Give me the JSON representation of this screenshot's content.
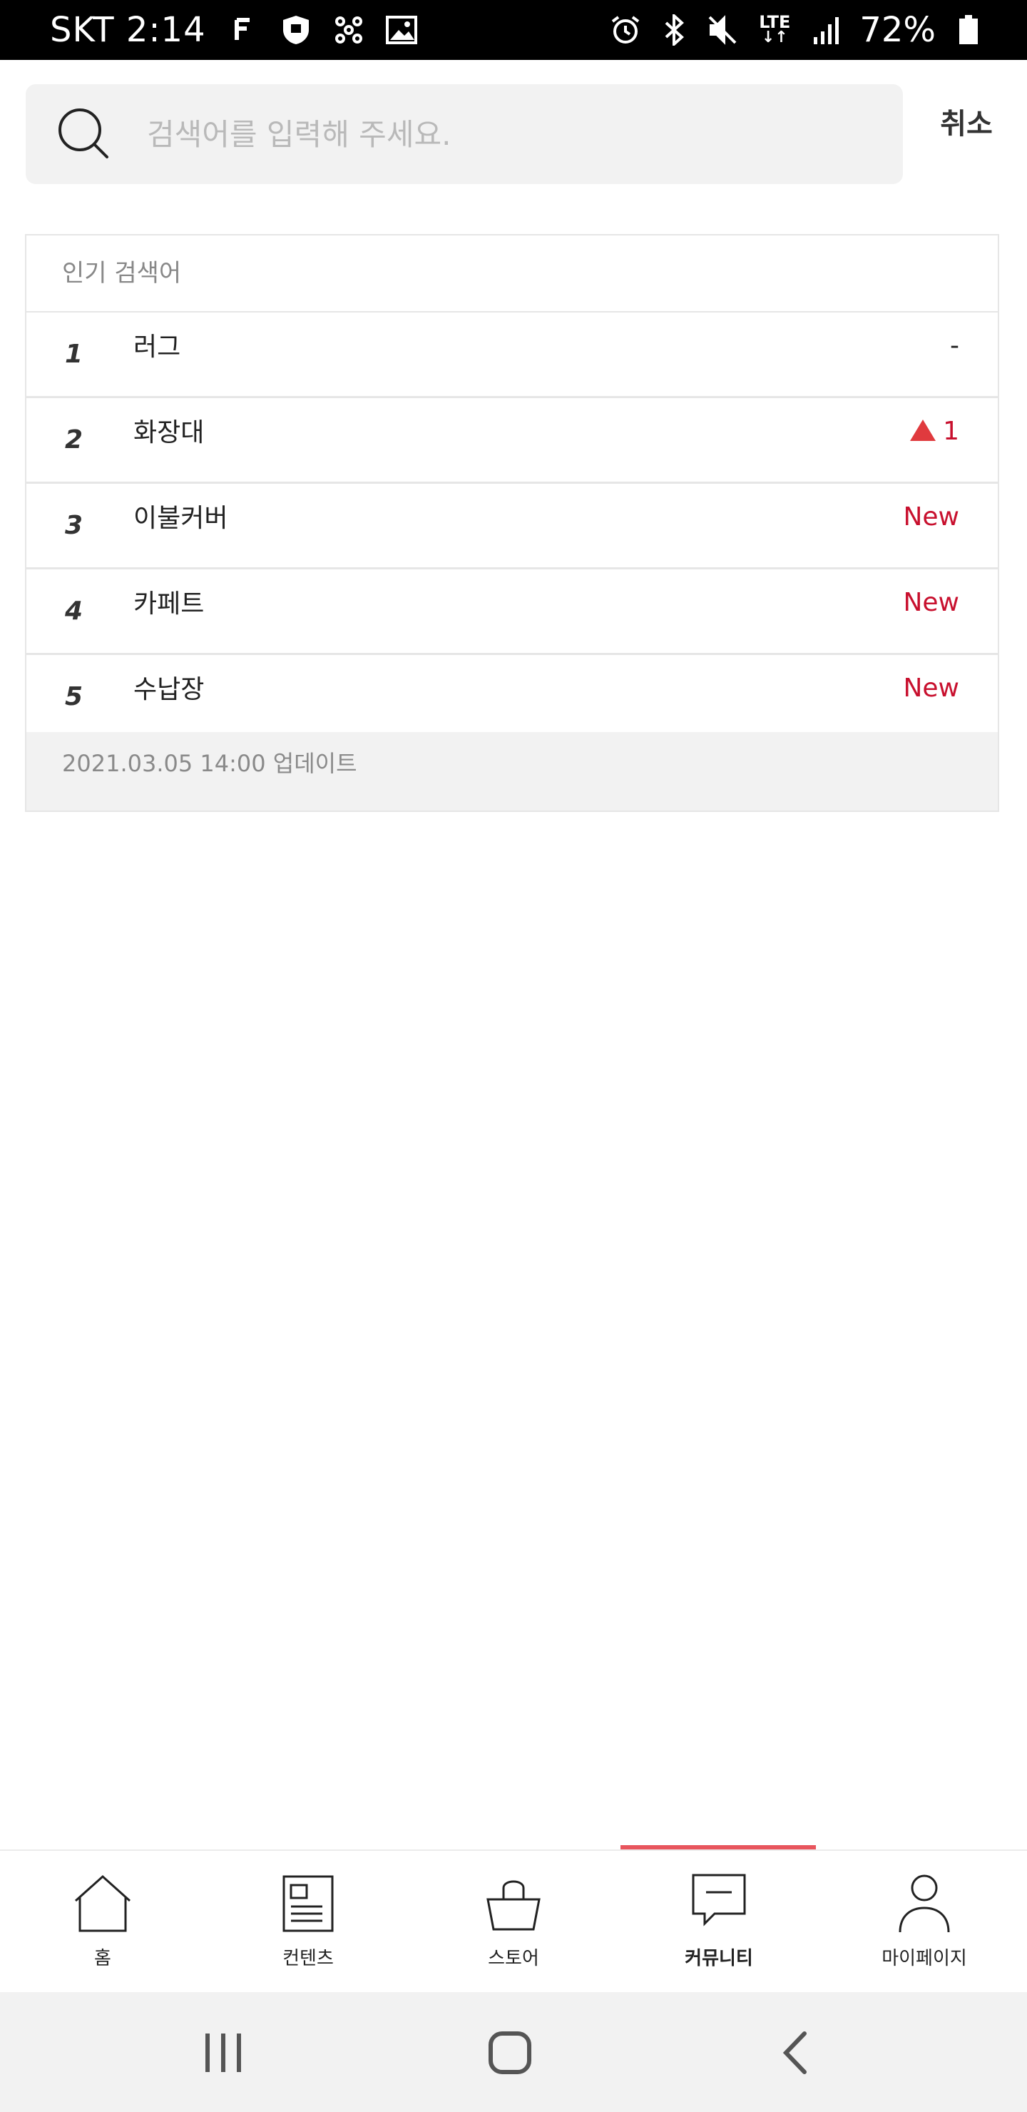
{
  "status_bar": {
    "carrier": "SKT",
    "time": "2:14",
    "network": "LTE",
    "battery": "72%",
    "icons": [
      "f-notification-icon",
      "shield-icon",
      "network-nodes-icon",
      "image-icon",
      "alarm-icon",
      "bluetooth-icon",
      "mute-icon",
      "signal-icon",
      "battery-icon"
    ]
  },
  "search": {
    "placeholder": "검색어를 입력해 주세요.",
    "value": "",
    "cancel_label": "취소"
  },
  "popular": {
    "title": "인기 검색어",
    "items": [
      {
        "rank": "1",
        "keyword": "러그",
        "change": "-"
      },
      {
        "rank": "2",
        "keyword": "화장대",
        "change": "1",
        "direction": "up"
      },
      {
        "rank": "3",
        "keyword": "이불커버",
        "change": "New"
      },
      {
        "rank": "4",
        "keyword": "카페트",
        "change": "New"
      },
      {
        "rank": "5",
        "keyword": "수납장",
        "change": "New"
      }
    ],
    "updated": "2021.03.05 14:00 업데이트"
  },
  "bottom_nav": {
    "items": [
      {
        "label": "홈",
        "icon": "home-icon"
      },
      {
        "label": "컨텐츠",
        "icon": "contents-icon"
      },
      {
        "label": "스토어",
        "icon": "basket-icon"
      },
      {
        "label": "커뮤니티",
        "icon": "chat-icon"
      },
      {
        "label": "마이페이지",
        "icon": "person-icon"
      }
    ],
    "active": "커뮤니티"
  },
  "system_nav": {
    "buttons": [
      "recent-apps-icon",
      "home-circle-icon",
      "back-icon"
    ]
  },
  "colors": {
    "accent": "#e8555d",
    "change_red": "#c8102e",
    "up_arrow": "#e03a3e",
    "panel_border": "#e6e6e6",
    "gray_bg": "#f2f2f2"
  }
}
